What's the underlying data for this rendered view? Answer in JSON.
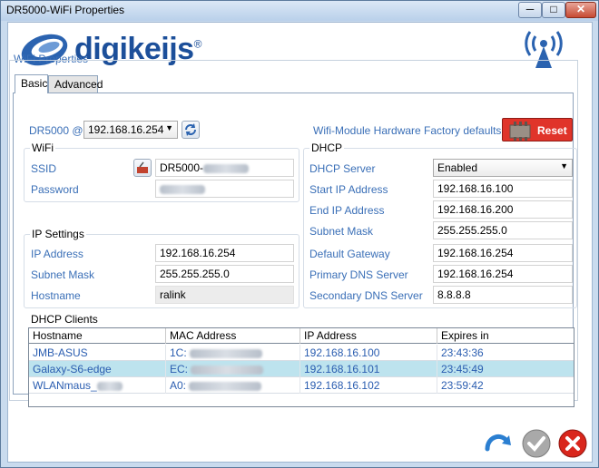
{
  "window": {
    "title": "DR5000-WiFi Properties",
    "min_glyph": "─",
    "max_glyph": "□",
    "close_glyph": "✕"
  },
  "logo": {
    "text": "digikeijs",
    "reg": "®"
  },
  "section_title": "WiFi Properties",
  "tabs": [
    {
      "label": "Basic",
      "active": true
    },
    {
      "label": "Advanced",
      "active": false
    }
  ],
  "device": {
    "label": "DR5000 @",
    "ip": "192.168.16.254",
    "factory_label": "Wifi-Module Hardware Factory defaults",
    "reset_label": "Reset"
  },
  "wifi": {
    "title": "WiFi",
    "ssid_label": "SSID",
    "ssid_value": "DR5000-",
    "password_label": "Password",
    "password_value": ""
  },
  "ip_settings": {
    "title": "IP Settings",
    "ip_label": "IP Address",
    "ip_value": "192.168.16.254",
    "mask_label": "Subnet Mask",
    "mask_value": "255.255.255.0",
    "host_label": "Hostname",
    "host_value": "ralink"
  },
  "dhcp": {
    "title": "DHCP",
    "server_label": "DHCP Server",
    "server_value": "Enabled",
    "start_label": "Start IP Address",
    "start_value": "192.168.16.100",
    "end_label": "End IP Address",
    "end_value": "192.168.16.200",
    "mask_label": "Subnet Mask",
    "mask_value": "255.255.255.0",
    "gw_label": "Default Gateway",
    "gw_value": "192.168.16.254",
    "dns1_label": "Primary DNS Server",
    "dns1_value": "192.168.16.254",
    "dns2_label": "Secondary DNS Server",
    "dns2_value": "8.8.8.8"
  },
  "clients": {
    "title": "DHCP Clients",
    "columns": [
      "Hostname",
      "MAC Address",
      "IP Address",
      "Expires in"
    ],
    "rows": [
      {
        "host": "JMB-ASUS",
        "mac": "1C:",
        "ip": "192.168.16.100",
        "expires": "23:43:36",
        "selected": false
      },
      {
        "host": "Galaxy-S6-edge",
        "mac": "EC:",
        "ip": "192.168.16.101",
        "expires": "23:45:49",
        "selected": true
      },
      {
        "host": "WLANmaus_",
        "mac": "A0:",
        "ip": "192.168.16.102",
        "expires": "23:59:42",
        "selected": false
      }
    ]
  },
  "colors": {
    "label_blue": "#3a6fb7",
    "selected_row": "#bde3ee",
    "reset_red": "#e0342a"
  }
}
